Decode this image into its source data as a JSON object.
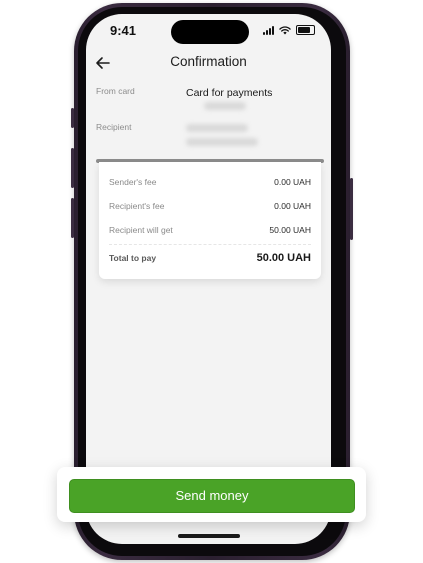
{
  "status_bar": {
    "time": "9:41"
  },
  "header": {
    "title": "Confirmation"
  },
  "details": {
    "from_card_label": "From card",
    "from_card_value": "Card for payments",
    "recipient_label": "Recipient"
  },
  "fees": {
    "rows": [
      {
        "label": "Sender's fee",
        "value": "0.00 UAH"
      },
      {
        "label": "Recipient's fee",
        "value": "0.00 UAH"
      },
      {
        "label": "Recipient will get",
        "value": "50.00 UAH"
      }
    ],
    "total_label": "Total to pay",
    "total_value": "50.00 UAH"
  },
  "actions": {
    "send_label": "Send money"
  },
  "colors": {
    "accent": "#4aa327",
    "screen_bg": "#f3f3f3",
    "frame": "#2b2030"
  },
  "icons": [
    "back-arrow-icon",
    "signal-icon",
    "wifi-icon",
    "battery-icon"
  ]
}
